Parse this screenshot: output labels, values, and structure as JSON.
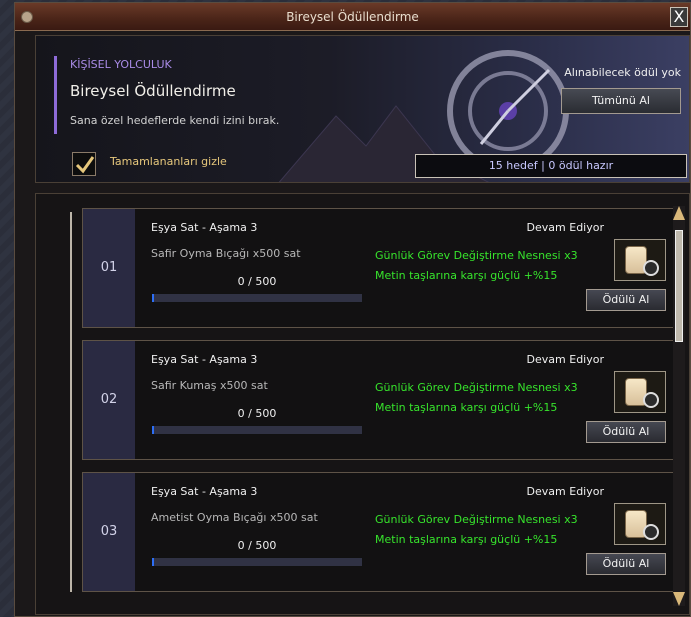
{
  "window": {
    "title": "Bireysel Ödüllendirme",
    "close": "X"
  },
  "banner": {
    "subtitle": "KİŞİSEL YOLCULUK",
    "title": "Bireysel Ödüllendirme",
    "description": "Sana özel hedeflerde kendi izini bırak.",
    "hide_completed_label": "Tamamlananları gizle",
    "hide_completed_checked": true,
    "reward_info": "Alınabilecek ödül yok",
    "claim_all_label": "Tümünü Al",
    "status": "15 hedef | 0 ödül hazır"
  },
  "quests": [
    {
      "index": "01",
      "title": "Eşya Sat - Aşama 3",
      "description": "Safir Oyma Bıçağı x500 sat",
      "progress_text": "0 / 500",
      "progress_fraction": 0.0,
      "status": "Devam Ediyor",
      "rewards": [
        "Günlük Görev Değiştirme Nesnesi x3",
        "Metin taşlarına karşı güçlü +%15"
      ],
      "reward_icon": "scroll-icon",
      "claim_label": "Ödülü Al"
    },
    {
      "index": "02",
      "title": "Eşya Sat - Aşama 3",
      "description": "Safir Kumaş x500 sat",
      "progress_text": "0 / 500",
      "progress_fraction": 0.0,
      "status": "Devam Ediyor",
      "rewards": [
        "Günlük Görev Değiştirme Nesnesi x3",
        "Metin taşlarına karşı güçlü +%15"
      ],
      "reward_icon": "scroll-icon",
      "claim_label": "Ödülü Al"
    },
    {
      "index": "03",
      "title": "Eşya Sat - Aşama 3",
      "description": "Ametist Oyma Bıçağı x500 sat",
      "progress_text": "0 / 500",
      "progress_fraction": 0.0,
      "status": "Devam Ediyor",
      "rewards": [
        "Günlük Görev Değiştirme Nesnesi x3",
        "Metin taşlarına karşı güçlü +%15"
      ],
      "reward_icon": "scroll-icon",
      "claim_label": "Ödülü Al"
    }
  ],
  "colors": {
    "accent": "#8e6bd8",
    "reward_text": "#37e52c",
    "progress_bar": "#2d6ef5"
  }
}
